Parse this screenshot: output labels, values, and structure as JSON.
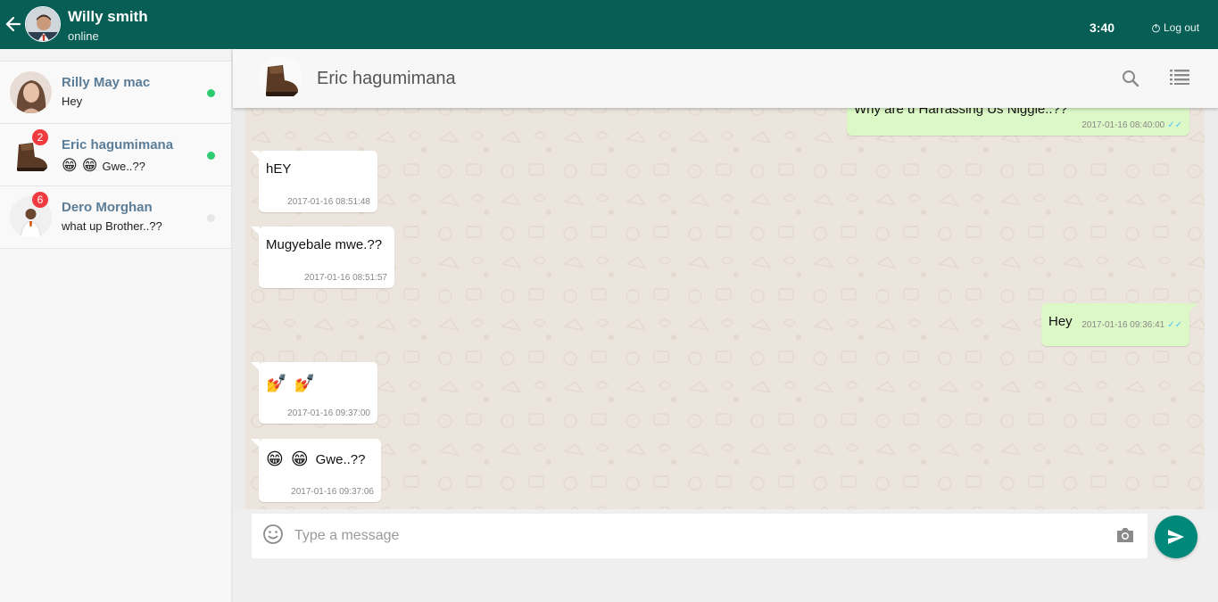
{
  "user": {
    "name": "Willy smith",
    "status": "online"
  },
  "clock": "3:40",
  "logout_label": "Log out",
  "contacts": [
    {
      "name": "Rilly May mac",
      "last_message": "Hey",
      "badge": "",
      "online": true
    },
    {
      "name": "Eric hagumimana",
      "last_message": "Gwe..??",
      "last_emojis": [
        "😁",
        "😁"
      ],
      "badge": "2",
      "online": true
    },
    {
      "name": "Dero Morghan",
      "last_message": "what up Brother..??",
      "badge": "6",
      "online": false
    }
  ],
  "chat": {
    "title": "Eric hagumimana",
    "messages": [
      {
        "dir": "out",
        "text": "Why are u Harrassing Us Niggie..??",
        "time": "2017-01-16 08:40:00"
      },
      {
        "dir": "in",
        "text": "hEY",
        "time": "2017-01-16 08:51:48"
      },
      {
        "dir": "in",
        "text": "Mugyebale mwe.??",
        "time": "2017-01-16 08:51:57"
      },
      {
        "dir": "out",
        "text": "Hey",
        "time": "2017-01-16 09:36:41"
      },
      {
        "dir": "in",
        "text": "",
        "emojis": [
          "💅",
          "💅"
        ],
        "time": "2017-01-16 09:37:00"
      },
      {
        "dir": "in",
        "text": "Gwe..??",
        "emojis": [
          "😁",
          "😁"
        ],
        "time": "2017-01-16 09:37:06"
      }
    ]
  },
  "composer": {
    "placeholder": "Type a message"
  },
  "colors": {
    "header": "#075e54",
    "accent": "#00897b",
    "online": "#2ecc71",
    "badge": "#ef3b3f",
    "outgoing": "#dcf8c6"
  },
  "icons": {
    "back": "arrow-left-icon",
    "logout": "power-icon",
    "search": "search-icon",
    "menu": "list-icon",
    "emoji": "smiley-icon",
    "camera": "camera-icon",
    "send": "send-icon"
  }
}
